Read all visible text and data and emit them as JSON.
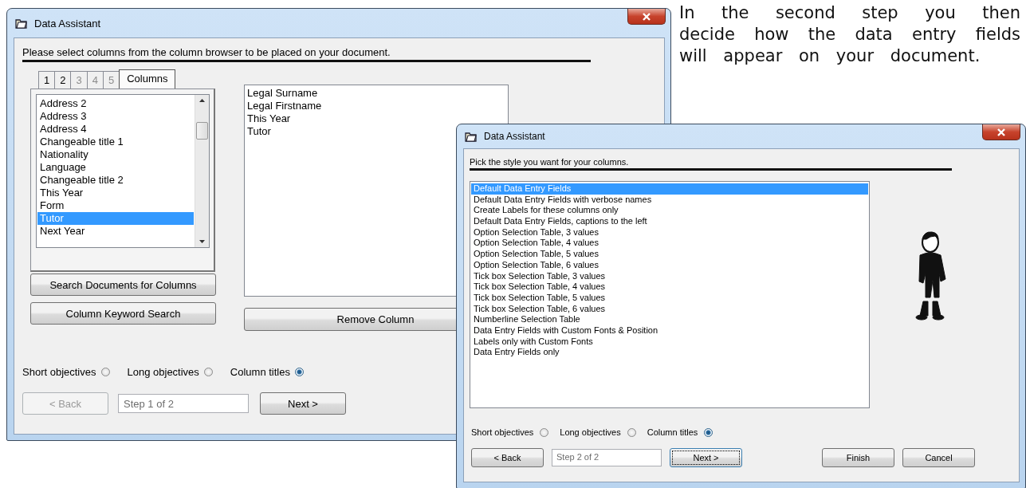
{
  "description": {
    "text": "In the second step you then decide how the data entry fields will appear on your document."
  },
  "windows": [
    {
      "kind": "column_picker",
      "title": "Data Assistant",
      "instruction": "Please select columns from the column browser to be placed on your document.",
      "tabs": [
        {
          "label": "1",
          "selected": false,
          "disabled": false
        },
        {
          "label": "2",
          "selected": false,
          "disabled": false
        },
        {
          "label": "3",
          "selected": false,
          "disabled": true
        },
        {
          "label": "4",
          "selected": false,
          "disabled": true
        },
        {
          "label": "5",
          "selected": false,
          "disabled": true
        },
        {
          "label": "Columns",
          "selected": true,
          "disabled": false
        }
      ],
      "column_list": [
        {
          "label": "Address 2",
          "selected": false
        },
        {
          "label": "Address 3",
          "selected": false
        },
        {
          "label": "Address 4",
          "selected": false
        },
        {
          "label": "Changeable title 1",
          "selected": false
        },
        {
          "label": "Nationality",
          "selected": false
        },
        {
          "label": "Language",
          "selected": false
        },
        {
          "label": "Changeable title 2",
          "selected": false
        },
        {
          "label": "This Year",
          "selected": false
        },
        {
          "label": "Form",
          "selected": false
        },
        {
          "label": "Tutor",
          "selected": true
        },
        {
          "label": "Next Year",
          "selected": false
        }
      ],
      "chosen_columns": [
        "Legal Surname",
        "Legal Firstname",
        "This Year",
        "Tutor"
      ],
      "side_buttons": [
        "Search Documents for Columns",
        "Column Keyword Search"
      ],
      "remove_button": "Remove Column",
      "options": [
        {
          "label": "Short objectives",
          "selected": false
        },
        {
          "label": "Long objectives",
          "selected": false
        },
        {
          "label": "Column titles",
          "selected": true
        }
      ],
      "nav": [
        {
          "kind": "button",
          "label": "< Back",
          "disabled": true,
          "focused": false
        },
        {
          "kind": "field",
          "value": "Step 1 of 2"
        },
        {
          "kind": "button",
          "label": "Next >",
          "disabled": false,
          "focused": false
        }
      ]
    },
    {
      "kind": "style_picker",
      "title": "Data Assistant",
      "instruction": "Pick the style you want for your columns.",
      "styles": [
        {
          "label": "Default Data Entry Fields",
          "selected": true
        },
        {
          "label": "Default Data Entry Fields with verbose names",
          "selected": false
        },
        {
          "label": "Create Labels for these columns only",
          "selected": false
        },
        {
          "label": "Default Data Entry Fields, captions to the left",
          "selected": false
        },
        {
          "label": "Option Selection Table, 3 values",
          "selected": false
        },
        {
          "label": "Option Selection Table, 4 values",
          "selected": false
        },
        {
          "label": "Option Selection Table, 5 values",
          "selected": false
        },
        {
          "label": "Option Selection Table, 6 values",
          "selected": false
        },
        {
          "label": "Tick box Selection Table, 3 values",
          "selected": false
        },
        {
          "label": "Tick box Selection Table, 4 values",
          "selected": false
        },
        {
          "label": "Tick box Selection Table, 5 values",
          "selected": false
        },
        {
          "label": "Tick box Selection Table, 6 values",
          "selected": false
        },
        {
          "label": "Numberline Selection Table",
          "selected": false
        },
        {
          "label": "Data Entry Fields with Custom Fonts & Position",
          "selected": false
        },
        {
          "label": "Labels only with Custom Fonts",
          "selected": false
        },
        {
          "label": "Data Entry Fields only",
          "selected": false
        }
      ],
      "options": [
        {
          "label": "Short objectives",
          "selected": false
        },
        {
          "label": "Long objectives",
          "selected": false
        },
        {
          "label": "Column titles",
          "selected": true
        }
      ],
      "nav": [
        {
          "kind": "button",
          "label": "< Back",
          "disabled": false,
          "focused": false
        },
        {
          "kind": "field",
          "value": "Step 2 of 2"
        },
        {
          "kind": "button",
          "label": "Next >",
          "disabled": false,
          "focused": true
        },
        {
          "kind": "spacer"
        },
        {
          "kind": "button",
          "label": "Finish",
          "disabled": false,
          "focused": false
        },
        {
          "kind": "button",
          "label": "Cancel",
          "disabled": false,
          "focused": false
        }
      ]
    }
  ]
}
